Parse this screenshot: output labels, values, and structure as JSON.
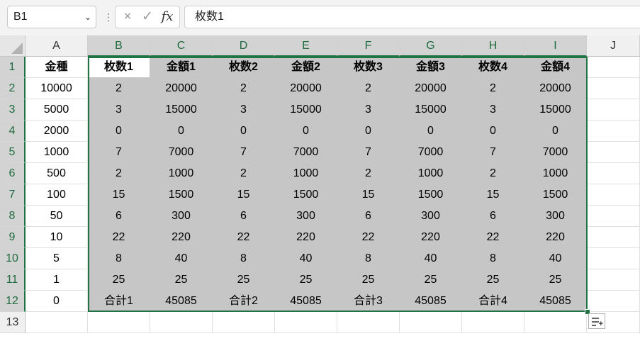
{
  "formula_bar": {
    "name_box": "B1",
    "cancel_icon": "×",
    "enter_icon": "✓",
    "fx_label": "fx",
    "formula": "枚数1"
  },
  "columns": [
    "A",
    "B",
    "C",
    "D",
    "E",
    "F",
    "G",
    "H",
    "I",
    "J"
  ],
  "rows": [
    "1",
    "2",
    "3",
    "4",
    "5",
    "6",
    "7",
    "8",
    "9",
    "10",
    "11",
    "12",
    "13"
  ],
  "cells": [
    [
      "金種",
      "枚数1",
      "金額1",
      "枚数2",
      "金額2",
      "枚数3",
      "金額3",
      "枚数4",
      "金額4",
      ""
    ],
    [
      "10000",
      "2",
      "20000",
      "2",
      "20000",
      "2",
      "20000",
      "2",
      "20000",
      ""
    ],
    [
      "5000",
      "3",
      "15000",
      "3",
      "15000",
      "3",
      "15000",
      "3",
      "15000",
      ""
    ],
    [
      "2000",
      "0",
      "0",
      "0",
      "0",
      "0",
      "0",
      "0",
      "0",
      ""
    ],
    [
      "1000",
      "7",
      "7000",
      "7",
      "7000",
      "7",
      "7000",
      "7",
      "7000",
      ""
    ],
    [
      "500",
      "2",
      "1000",
      "2",
      "1000",
      "2",
      "1000",
      "2",
      "1000",
      ""
    ],
    [
      "100",
      "15",
      "1500",
      "15",
      "1500",
      "15",
      "1500",
      "15",
      "1500",
      ""
    ],
    [
      "50",
      "6",
      "300",
      "6",
      "300",
      "6",
      "300",
      "6",
      "300",
      ""
    ],
    [
      "10",
      "22",
      "220",
      "22",
      "220",
      "22",
      "220",
      "22",
      "220",
      ""
    ],
    [
      "5",
      "8",
      "40",
      "8",
      "40",
      "8",
      "40",
      "8",
      "40",
      ""
    ],
    [
      "1",
      "25",
      "25",
      "25",
      "25",
      "25",
      "25",
      "25",
      "25",
      ""
    ],
    [
      "0",
      "合計1",
      "45085",
      "合計2",
      "45085",
      "合計3",
      "45085",
      "合計4",
      "45085",
      ""
    ],
    [
      "",
      "",
      "",
      "",
      "",
      "",
      "",
      "",
      "",
      ""
    ]
  ],
  "selection": {
    "active_cell": "B1",
    "range": "B1:I12"
  },
  "colors": {
    "accent": "#217346",
    "selected_fill": "#c6c6c6",
    "header_fill": "#f0f0f0"
  },
  "quick_analysis_icon": "quick-analysis-icon"
}
